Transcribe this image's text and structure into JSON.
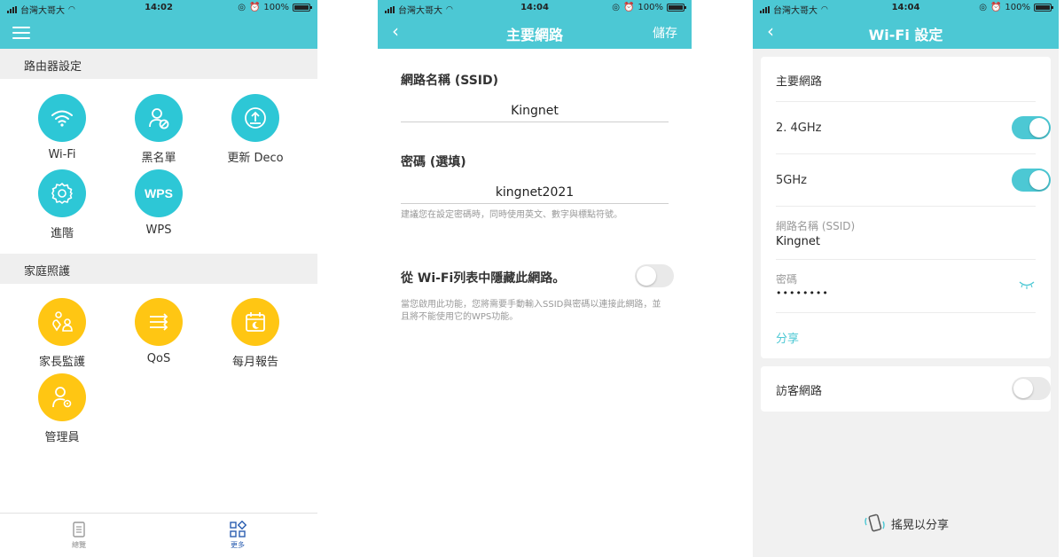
{
  "status_bar": {
    "carrier": "台灣大哥大",
    "time_p1": "14:02",
    "time_p2": "14:04",
    "time_p3": "14:04",
    "battery": "100%"
  },
  "panel1": {
    "section_router": "路由器設定",
    "router_tiles": [
      {
        "label": "Wi-Fi",
        "icon": "wifi-icon"
      },
      {
        "label": "黑名單",
        "icon": "user-block-icon"
      },
      {
        "label": "更新 Deco",
        "icon": "update-icon"
      },
      {
        "label": "進階",
        "icon": "gear-icon"
      },
      {
        "label": "WPS",
        "icon": "wps-icon",
        "icon_text": "WPS"
      }
    ],
    "section_family": "家庭照護",
    "family_tiles": [
      {
        "label": "家長監護",
        "icon": "parental-control-icon"
      },
      {
        "label": "QoS",
        "icon": "qos-icon"
      },
      {
        "label": "每月報告",
        "icon": "calendar-report-icon"
      },
      {
        "label": "管理員",
        "icon": "admin-icon"
      }
    ],
    "tabs": [
      {
        "label": "總覽",
        "icon": "overview-icon",
        "active": false
      },
      {
        "label": "更多",
        "icon": "more-icon",
        "active": true
      }
    ]
  },
  "panel2": {
    "title": "主要網路",
    "save": "儲存",
    "ssid_label": "網路名稱 (SSID)",
    "ssid_value": "Kingnet",
    "password_label": "密碼 (選填)",
    "password_value": "kingnet2021",
    "password_hint": "建議您在設定密碼時，同時使用英文、數字與標點符號。",
    "hide_label": "從 Wi-Fi列表中隱藏此網路。",
    "hide_on": false,
    "hide_hint": "當您啟用此功能，您將需要手動輸入SSID與密碼以連接此網路，並且將不能使用它的WPS功能。"
  },
  "panel3": {
    "title": "Wi-Fi 設定",
    "main_network": "主要網路",
    "band_24": "2. 4GHz",
    "band_24_on": true,
    "band_5": "5GHz",
    "band_5_on": true,
    "ssid_label": "網路名稱 (SSID)",
    "ssid_value": "Kingnet",
    "password_label": "密碼",
    "password_value": "••••••••",
    "share": "分享",
    "guest_network": "訪客網路",
    "guest_on": false,
    "shake_to_share": "搖晃以分享"
  },
  "colors": {
    "accent": "#4cc8d4",
    "tile_teal": "#2dc7d6",
    "tile_yellow": "#ffc613",
    "tab_active": "#2a5db0"
  }
}
